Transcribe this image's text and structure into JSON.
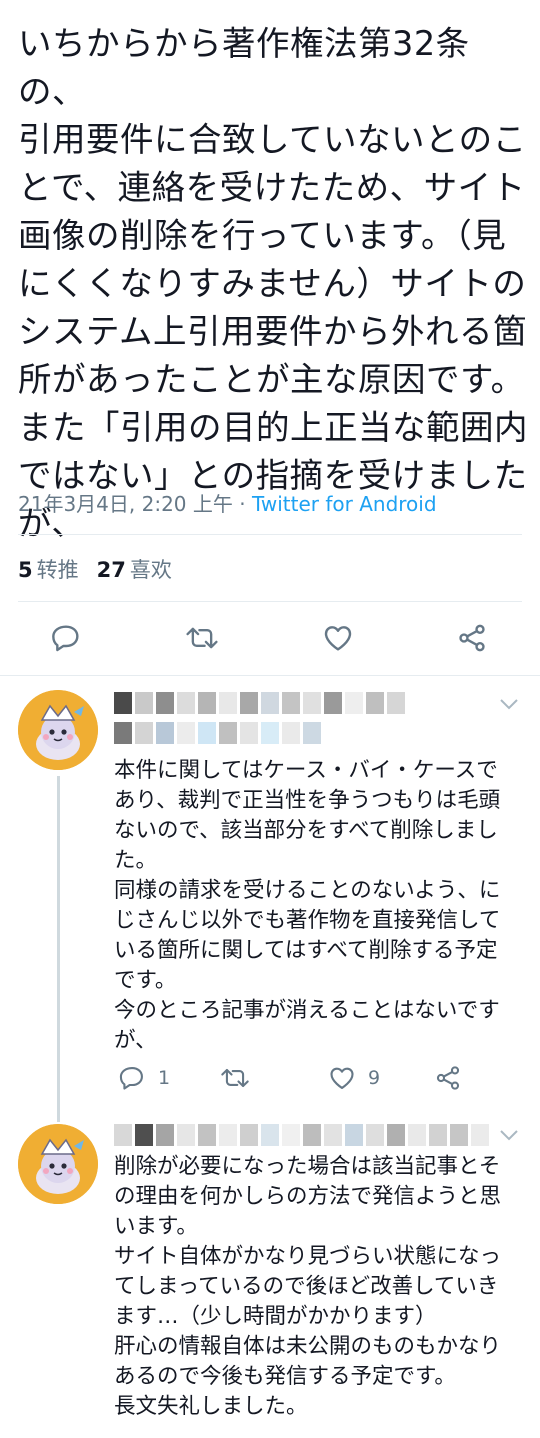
{
  "tweet": {
    "text": "いちからから著作権法第32条の、\n引用要件に合致していないとのこ\nとで、連絡を受けたため、サイト\n画像の削除を行っています。（見\nにくくなりすみません）サイトの\nシステム上引用要件から外れる箇\n所があったことが主な原因です。\nまた「引用の目的上正当な範囲内\nではない」との指摘を受けました\nが、",
    "timestamp": "21年3月4日, 2:20 上午",
    "separator": " · ",
    "via": "Twitter for Android",
    "retweets_count": "5",
    "retweets_label": "转推",
    "likes_count": "27",
    "likes_label": "喜欢"
  },
  "actions": {
    "icons": [
      "reply-icon",
      "retweet-icon",
      "like-icon",
      "share-icon"
    ]
  },
  "replies": [
    {
      "text": "本件に関してはケース・バイ・ケースで\nあり、裁判で正当性を争うつもりは毛頭\nないので、該当部分をすべて削除しまし\nた。\n同様の請求を受けることのないよう、に\nじさんじ以外でも著作物を直接発信して\nいる箇所に関してはすべて削除する予定\nです。\n今のところ記事が消えることはないです\nが、",
      "reply_count": "1",
      "like_count": "9"
    },
    {
      "text": "削除が必要になった場合は該当記事とそ\nの理由を何かしらの方法で発信ようと思\nいます。\nサイト自体がかなり見づらい状態になっ\nてしまっているので後ほど改善していき\nます…（少し時間がかかります）\n肝心の情報自体は未公開のものもかなり\nあるので今後も発信する予定です。\n長文失礼しました。"
    }
  ],
  "colors": {
    "accent": "#1da1f2",
    "muted": "#657786",
    "text": "#141823",
    "divider": "#e6ecf0",
    "avatar_bg": "#f0ae33"
  }
}
